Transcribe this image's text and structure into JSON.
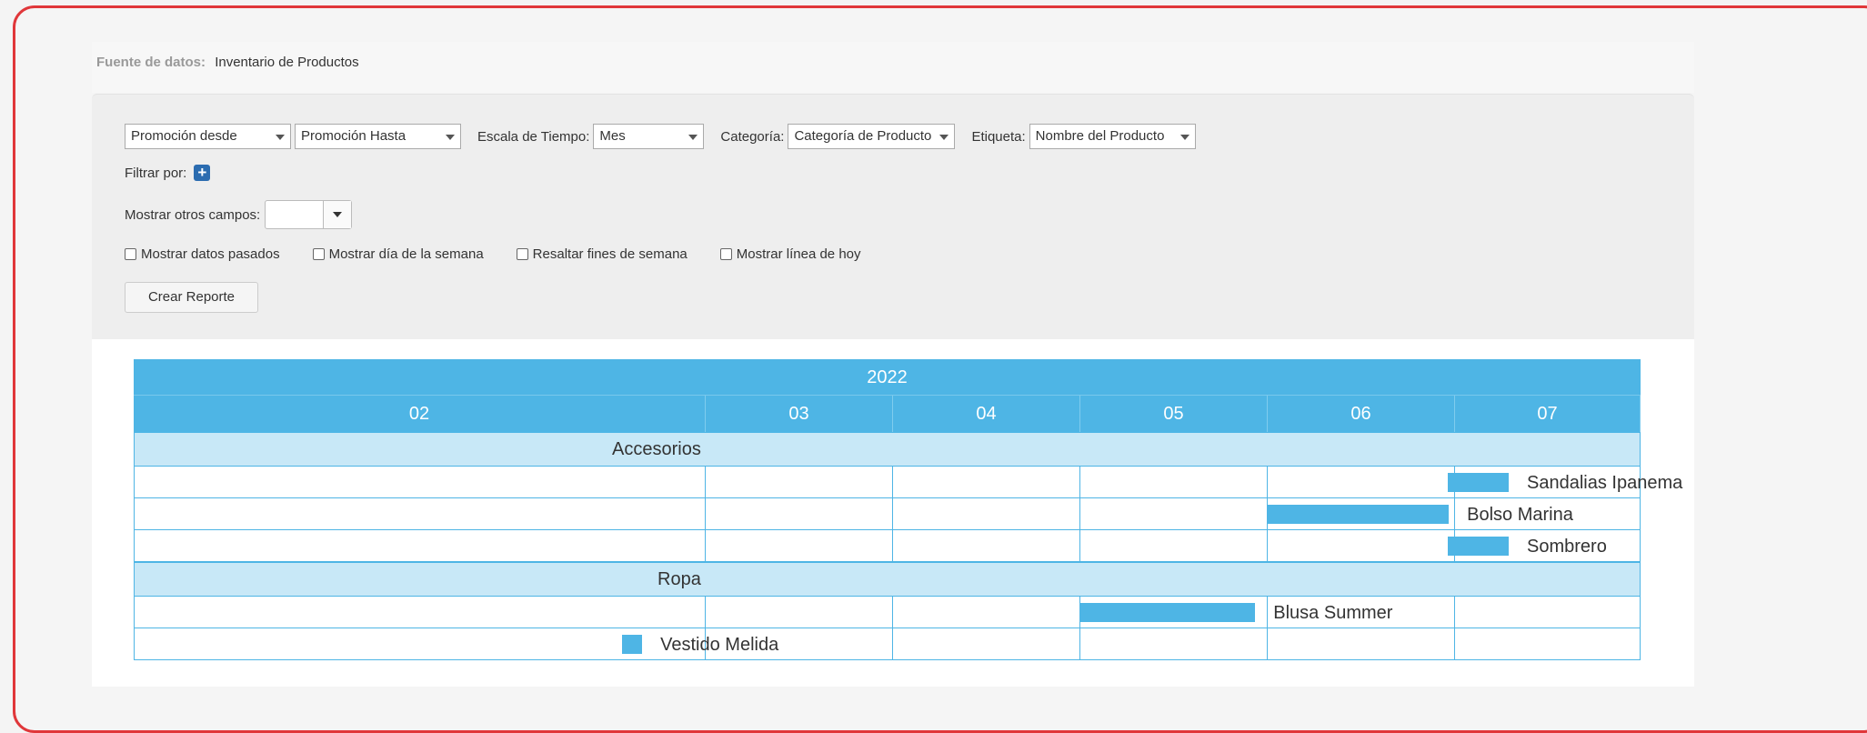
{
  "data_source": {
    "label": "Fuente de datos:",
    "value": "Inventario de Productos"
  },
  "controls": {
    "from_select": "Promoción desde",
    "to_select": "Promoción Hasta",
    "time_scale_label": "Escala de Tiempo:",
    "time_scale_value": "Mes",
    "category_label": "Categoría:",
    "category_value": "Categoría de Producto",
    "tag_label": "Etiqueta:",
    "tag_value": "Nombre del Producto",
    "filter_label": "Filtrar por:",
    "filter_add_icon": "plus-icon",
    "other_fields_label": "Mostrar otros campos:",
    "checkboxes": [
      "Mostrar datos pasados",
      "Mostrar día de la semana",
      "Resaltar fines de semana",
      "Mostrar línea de hoy"
    ],
    "create_button": "Crear Reporte"
  },
  "gantt": {
    "year": "2022",
    "months": [
      "02",
      "03",
      "04",
      "05",
      "06",
      "07"
    ],
    "groups": [
      {
        "name": "Accesorios",
        "items": [
          {
            "label": "Sandalias Ipanema",
            "start": "07-01",
            "end": "07-10"
          },
          {
            "label": "Bolso Marina",
            "start": "06-01",
            "end": "06-30"
          },
          {
            "label": "Sombrero",
            "start": "07-01",
            "end": "07-10"
          }
        ]
      },
      {
        "name": "Ropa",
        "items": [
          {
            "label": "Blusa Summer",
            "start": "05-01",
            "end": "05-29"
          },
          {
            "label": "Vestido Melida",
            "start": "02-27",
            "end": "02-28"
          }
        ]
      }
    ]
  },
  "colors": {
    "accent": "#4eb5e5",
    "group_row": "#c8e8f7",
    "frame": "#e0373a",
    "plus_button": "#2b6cb0"
  }
}
